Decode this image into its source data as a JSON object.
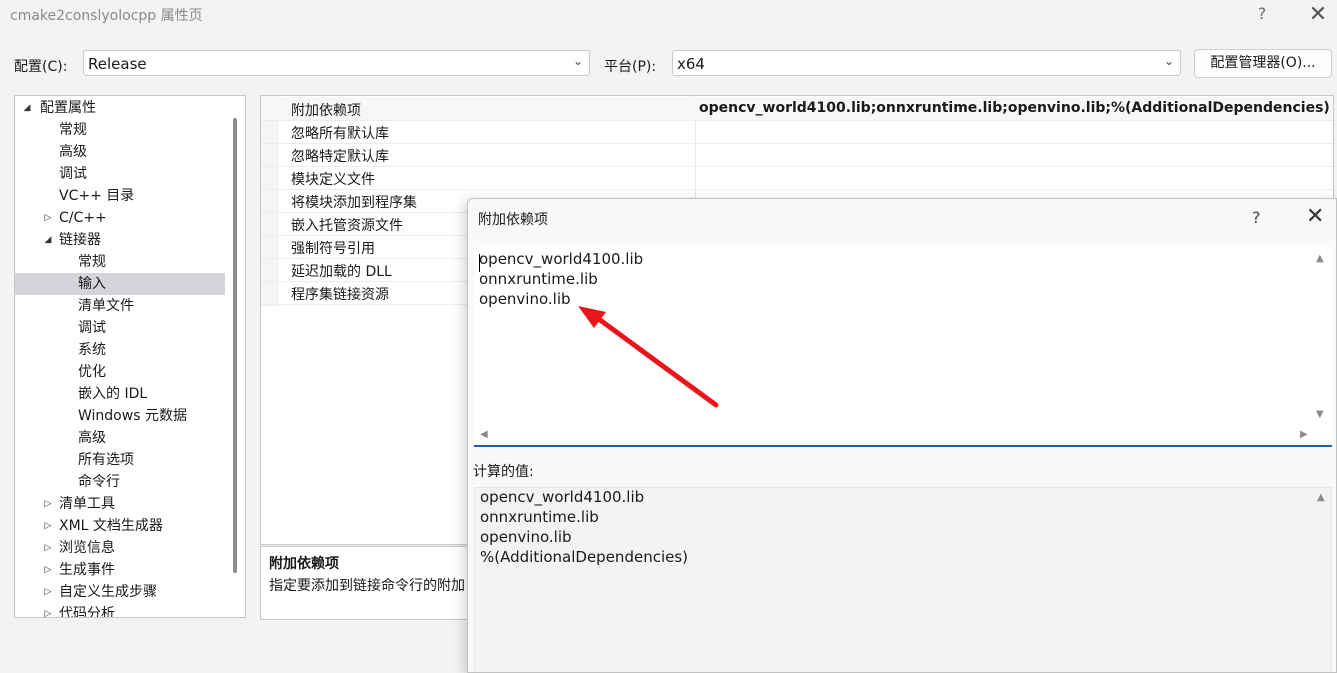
{
  "window": {
    "title": "cmake2conslyolocpp 属性页",
    "help": "?",
    "close": "✕"
  },
  "toolbar": {
    "config_label": "配置(C):",
    "config_value": "Release",
    "platform_label": "平台(P):",
    "platform_value": "x64",
    "manager_button": "配置管理器(O)..."
  },
  "tree": {
    "items": [
      {
        "label": "配置属性",
        "expand": "◢"
      },
      {
        "label": "常规"
      },
      {
        "label": "高级"
      },
      {
        "label": "调试"
      },
      {
        "label": "VC++ 目录"
      },
      {
        "label": "C/C++",
        "expand": "▷"
      },
      {
        "label": "链接器",
        "expand": "◢"
      },
      {
        "label": "常规"
      },
      {
        "label": "输入"
      },
      {
        "label": "清单文件"
      },
      {
        "label": "调试"
      },
      {
        "label": "系统"
      },
      {
        "label": "优化"
      },
      {
        "label": "嵌入的 IDL"
      },
      {
        "label": "Windows 元数据"
      },
      {
        "label": "高级"
      },
      {
        "label": "所有选项"
      },
      {
        "label": "命令行"
      },
      {
        "label": "清单工具",
        "expand": "▷"
      },
      {
        "label": "XML 文档生成器",
        "expand": "▷"
      },
      {
        "label": "浏览信息",
        "expand": "▷"
      },
      {
        "label": "生成事件",
        "expand": "▷"
      },
      {
        "label": "自定义生成步骤",
        "expand": "▷"
      },
      {
        "label": "代码分析",
        "expand": "▷"
      }
    ]
  },
  "grid": {
    "rows": [
      {
        "name": "附加依赖项",
        "value": "opencv_world4100.lib;onnxruntime.lib;openvino.lib;%(AdditionalDependencies)"
      },
      {
        "name": "忽略所有默认库",
        "value": ""
      },
      {
        "name": "忽略特定默认库",
        "value": ""
      },
      {
        "name": "模块定义文件",
        "value": ""
      },
      {
        "name": "将模块添加到程序集",
        "value": ""
      },
      {
        "name": "嵌入托管资源文件",
        "value": ""
      },
      {
        "name": "强制符号引用",
        "value": ""
      },
      {
        "name": "延迟加载的 DLL",
        "value": ""
      },
      {
        "name": "程序集链接资源",
        "value": ""
      }
    ]
  },
  "description": {
    "title": "附加依赖项",
    "text": "指定要添加到链接命令行的附加"
  },
  "dialog": {
    "title": "附加依赖项",
    "help": "?",
    "close": "✕",
    "edit_lines": [
      "opencv_world4100.lib",
      "onnxruntime.lib",
      "openvino.lib"
    ],
    "calc_label": "计算的值:",
    "calc_lines": [
      "opencv_world4100.lib",
      "onnxruntime.lib",
      "openvino.lib",
      "%(AdditionalDependencies)"
    ],
    "arrow_color": "#e8151b",
    "scroll": {
      "up": "▲",
      "down": "▼",
      "left": "◀",
      "right": "▶"
    }
  }
}
